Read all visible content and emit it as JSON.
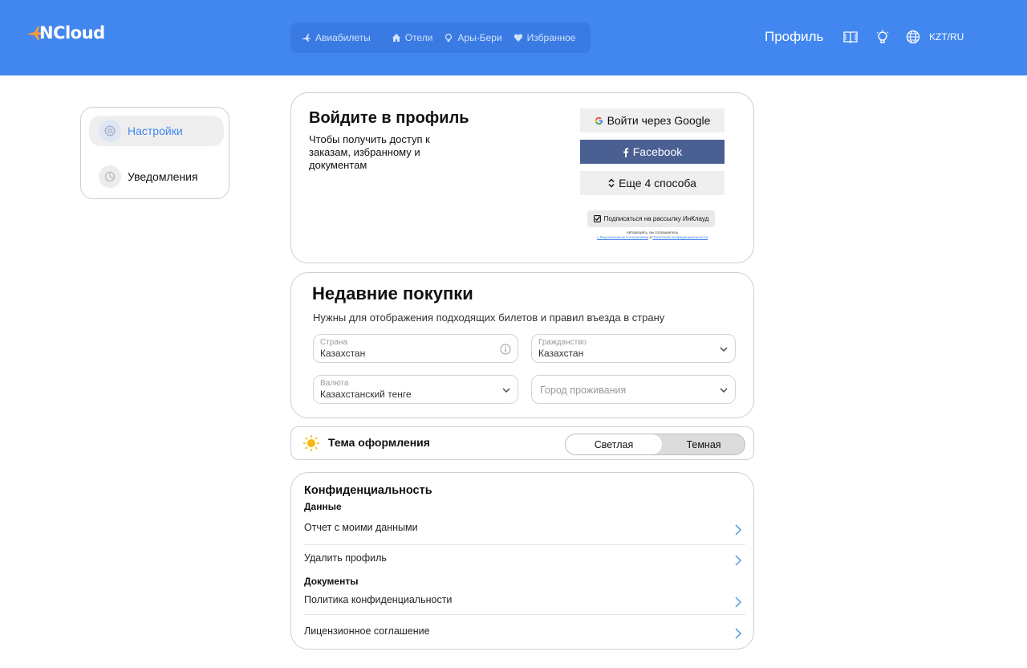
{
  "brand": {
    "logo_text": "NCloud"
  },
  "nav": [
    {
      "label": "Авиабилеты",
      "icon": "plane-icon"
    },
    {
      "label": "Отели",
      "icon": "home-icon"
    },
    {
      "label": "Ары-Бери",
      "icon": "bulb-icon"
    },
    {
      "label": "Избранное",
      "icon": "heart-icon"
    }
  ],
  "header": {
    "profile": "Профиль",
    "lang": "KZT/RU"
  },
  "sidebar": {
    "items": [
      {
        "label": "Настройки",
        "icon": "gear-icon",
        "active": true
      },
      {
        "label": "Уведомления",
        "icon": "bell-icon",
        "active": false
      }
    ]
  },
  "login": {
    "title": "Войдите в профиль",
    "subtitle": "Чтобы получить доступ к заказам, избранному и документам",
    "google": "Войти через Google",
    "facebook": "Facebook",
    "more": "Еще 4 способа",
    "newsletter": "Подписаться на рассылку ИнКлауд",
    "legal_line": "Авторизуясь, вы соглашаетесь",
    "legal_agreement": "с Лицензионным соглашением",
    "legal_and": "и",
    "legal_policy": "Политикой конфиденциальности"
  },
  "recent": {
    "title": "Недавние покупки",
    "subtitle": "Нужны для отображения подходящих  билетов и правил въезда в страну",
    "country_label": "Страна",
    "country_value": "Казахстан",
    "citizenship_label": "Гражданство",
    "citizenship_value": "Казахстан",
    "currency_label": "Валюта",
    "currency_value": "Казахстанский тенге",
    "city_placeholder": "Город проживания"
  },
  "theme": {
    "title": "Тема оформления",
    "light": "Светлая",
    "dark": "Темная",
    "selected": "Светлая"
  },
  "privacy": {
    "title": "Конфиденциальность",
    "data_section": "Данные",
    "report": "Отчет с моими данными",
    "delete": "Удалить профиль",
    "docs_section": "Документы",
    "policy": "Политика конфиденциальности",
    "license": "Лицензионное соглашение"
  },
  "colors": {
    "primary": "#4287f0",
    "nav_bg": "#3a7be3",
    "facebook": "#4a5f92",
    "sun": "#f5b70f"
  }
}
